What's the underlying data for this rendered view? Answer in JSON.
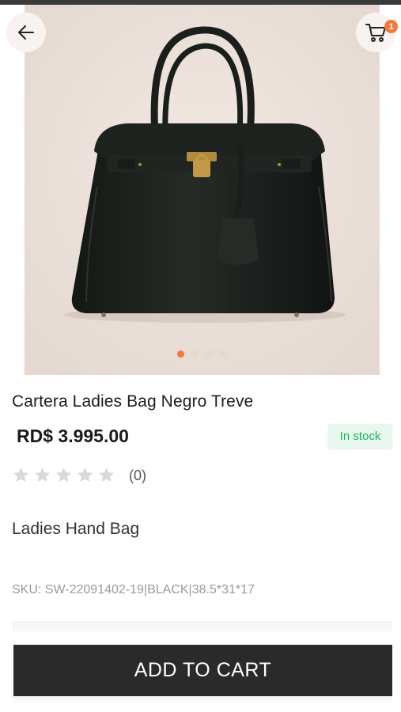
{
  "product": {
    "title": "Cartera Ladies Bag Negro Treve",
    "price": "RD$ 3.995.00",
    "stock_status": "In stock",
    "rating": 0,
    "rating_max": 5,
    "review_count": "(0)",
    "short_description": "Ladies Hand Bag",
    "sku": "SKU: SW-22091402-19|BLACK|38.5*31*17"
  },
  "gallery": {
    "image_count": 4,
    "active_index": 0,
    "image_subject": "black leather handbag with gold lock"
  },
  "header": {
    "back_icon": "arrow-left-icon",
    "cart_icon": "shopping-cart-icon",
    "cart_badge_count": "1"
  },
  "actions": {
    "add_to_cart_label": "ADD TO CART"
  },
  "colors": {
    "accent": "#f07a3c",
    "stock_text": "#1bb35c",
    "stock_bg": "#e8f8ef",
    "button_bg": "#2a2a2a"
  }
}
